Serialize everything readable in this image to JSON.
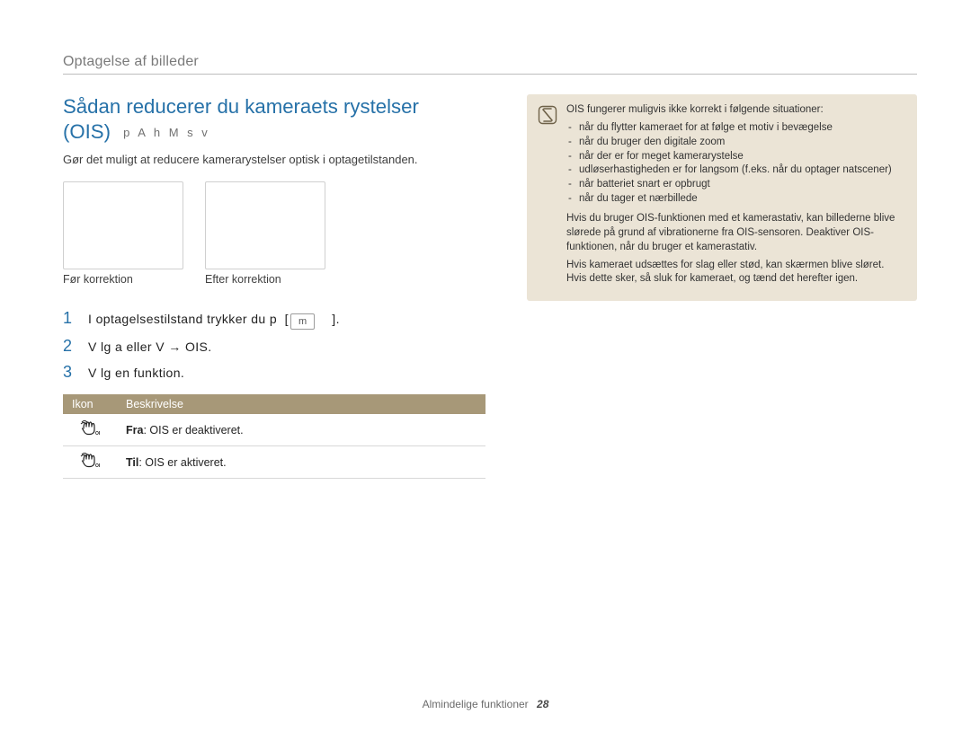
{
  "breadcrumb": "Optagelse af billeder",
  "title_line1": "Sådan reducerer du kameraets rystelser",
  "title_line2": "(OIS)",
  "mode_glyphs": "p A h M s v",
  "lede": "Gør det muligt at reducere kamerarystelser optisk i optagetilstanden.",
  "thumbs": {
    "before": "Før korrektion",
    "after": "Efter korrektion"
  },
  "steps": [
    {
      "num": "1",
      "pre": "I optagelsestilstand trykker du p",
      "key": "m",
      "post": "."
    },
    {
      "num": "2",
      "raw": "V  lg a     eller V    → OIS."
    },
    {
      "num": "3",
      "raw": "V  lg en funktion."
    }
  ],
  "table": {
    "head_icon": "Ikon",
    "head_desc": "Beskrivelse",
    "rows": [
      {
        "icon": "ois-off",
        "bold": "Fra",
        "rest": ": OIS er deaktiveret."
      },
      {
        "icon": "ois-on",
        "bold": "Til",
        "rest": ": OIS er aktiveret."
      }
    ]
  },
  "callout": {
    "intro": "OIS fungerer muligvis ikke korrekt i følgende situationer:",
    "items": [
      "når du flytter kameraet for at følge et motiv i bevægelse",
      "når du bruger den digitale zoom",
      "når der er for meget kamerarystelse",
      "udløserhastigheden er for langsom (f.eks. når du optager natscener)",
      "når batteriet snart er opbrugt",
      "når du tager et nærbillede"
    ],
    "para1": "Hvis du bruger OIS-funktionen med et kamerastativ, kan billederne blive slørede på grund af vibrationerne fra OIS-sensoren. Deaktiver OIS-funktionen, når du bruger et kamerastativ.",
    "para2": "Hvis kameraet udsættes for slag eller stød, kan skærmen blive sløret. Hvis dette sker, så sluk for kameraet, og tænd det herefter igen."
  },
  "footer_section": "Almindelige funktioner",
  "footer_page": "28"
}
